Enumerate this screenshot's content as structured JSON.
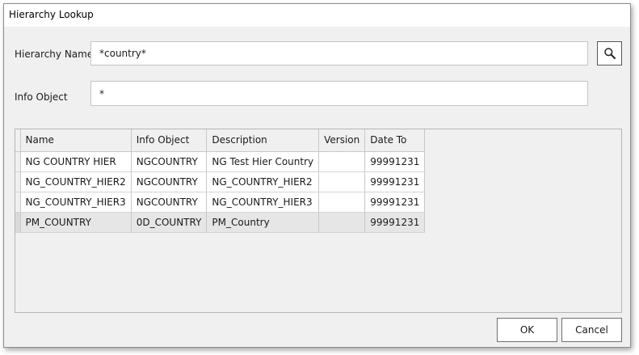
{
  "window": {
    "title": "Hierarchy Lookup"
  },
  "form": {
    "hierarchy_name_label": "Hierarchy Name",
    "hierarchy_name_value": "*country*",
    "info_object_label": "Info Object",
    "info_object_value": "*"
  },
  "search": {
    "icon": "search-icon"
  },
  "table": {
    "columns": [
      "Name",
      "Info Object",
      "Description",
      "Version",
      "Date To"
    ],
    "rows": [
      [
        "NG COUNTRY HIER",
        "NGCOUNTRY",
        "NG Test Hier Country",
        "",
        "99991231"
      ],
      [
        "NG_COUNTRY_HIER2",
        "NGCOUNTRY",
        "NG_COUNTRY_HIER2",
        "",
        "99991231"
      ],
      [
        "NG_COUNTRY_HIER3",
        "NGCOUNTRY",
        "NG_COUNTRY_HIER3",
        "",
        "99991231"
      ],
      [
        "PM_COUNTRY",
        "0D_COUNTRY",
        "PM_Country",
        "",
        "99991231"
      ]
    ],
    "selected_row": 3
  },
  "buttons": {
    "ok": "OK",
    "cancel": "Cancel"
  }
}
